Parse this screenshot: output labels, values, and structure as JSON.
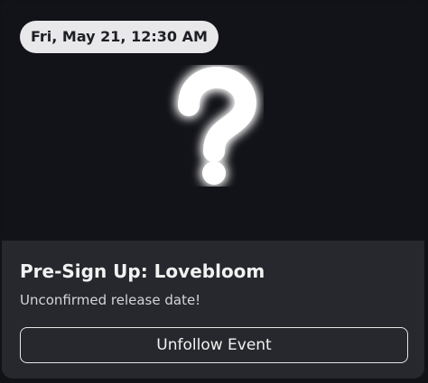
{
  "event": {
    "date_label": "Fri, May 21, 12:30 AM",
    "title": "Pre-Sign Up: Lovebloom",
    "subtitle": "Unconfirmed release date!",
    "thumbnail_icon": "question-mark-icon"
  },
  "actions": {
    "unfollow_label": "Unfollow Event"
  },
  "colors": {
    "card_background": "#26282d",
    "thumbnail_background": "#121318",
    "pill_background": "#e8e8ea",
    "text_primary": "#f2f2f2",
    "glow": "#ffffff"
  }
}
